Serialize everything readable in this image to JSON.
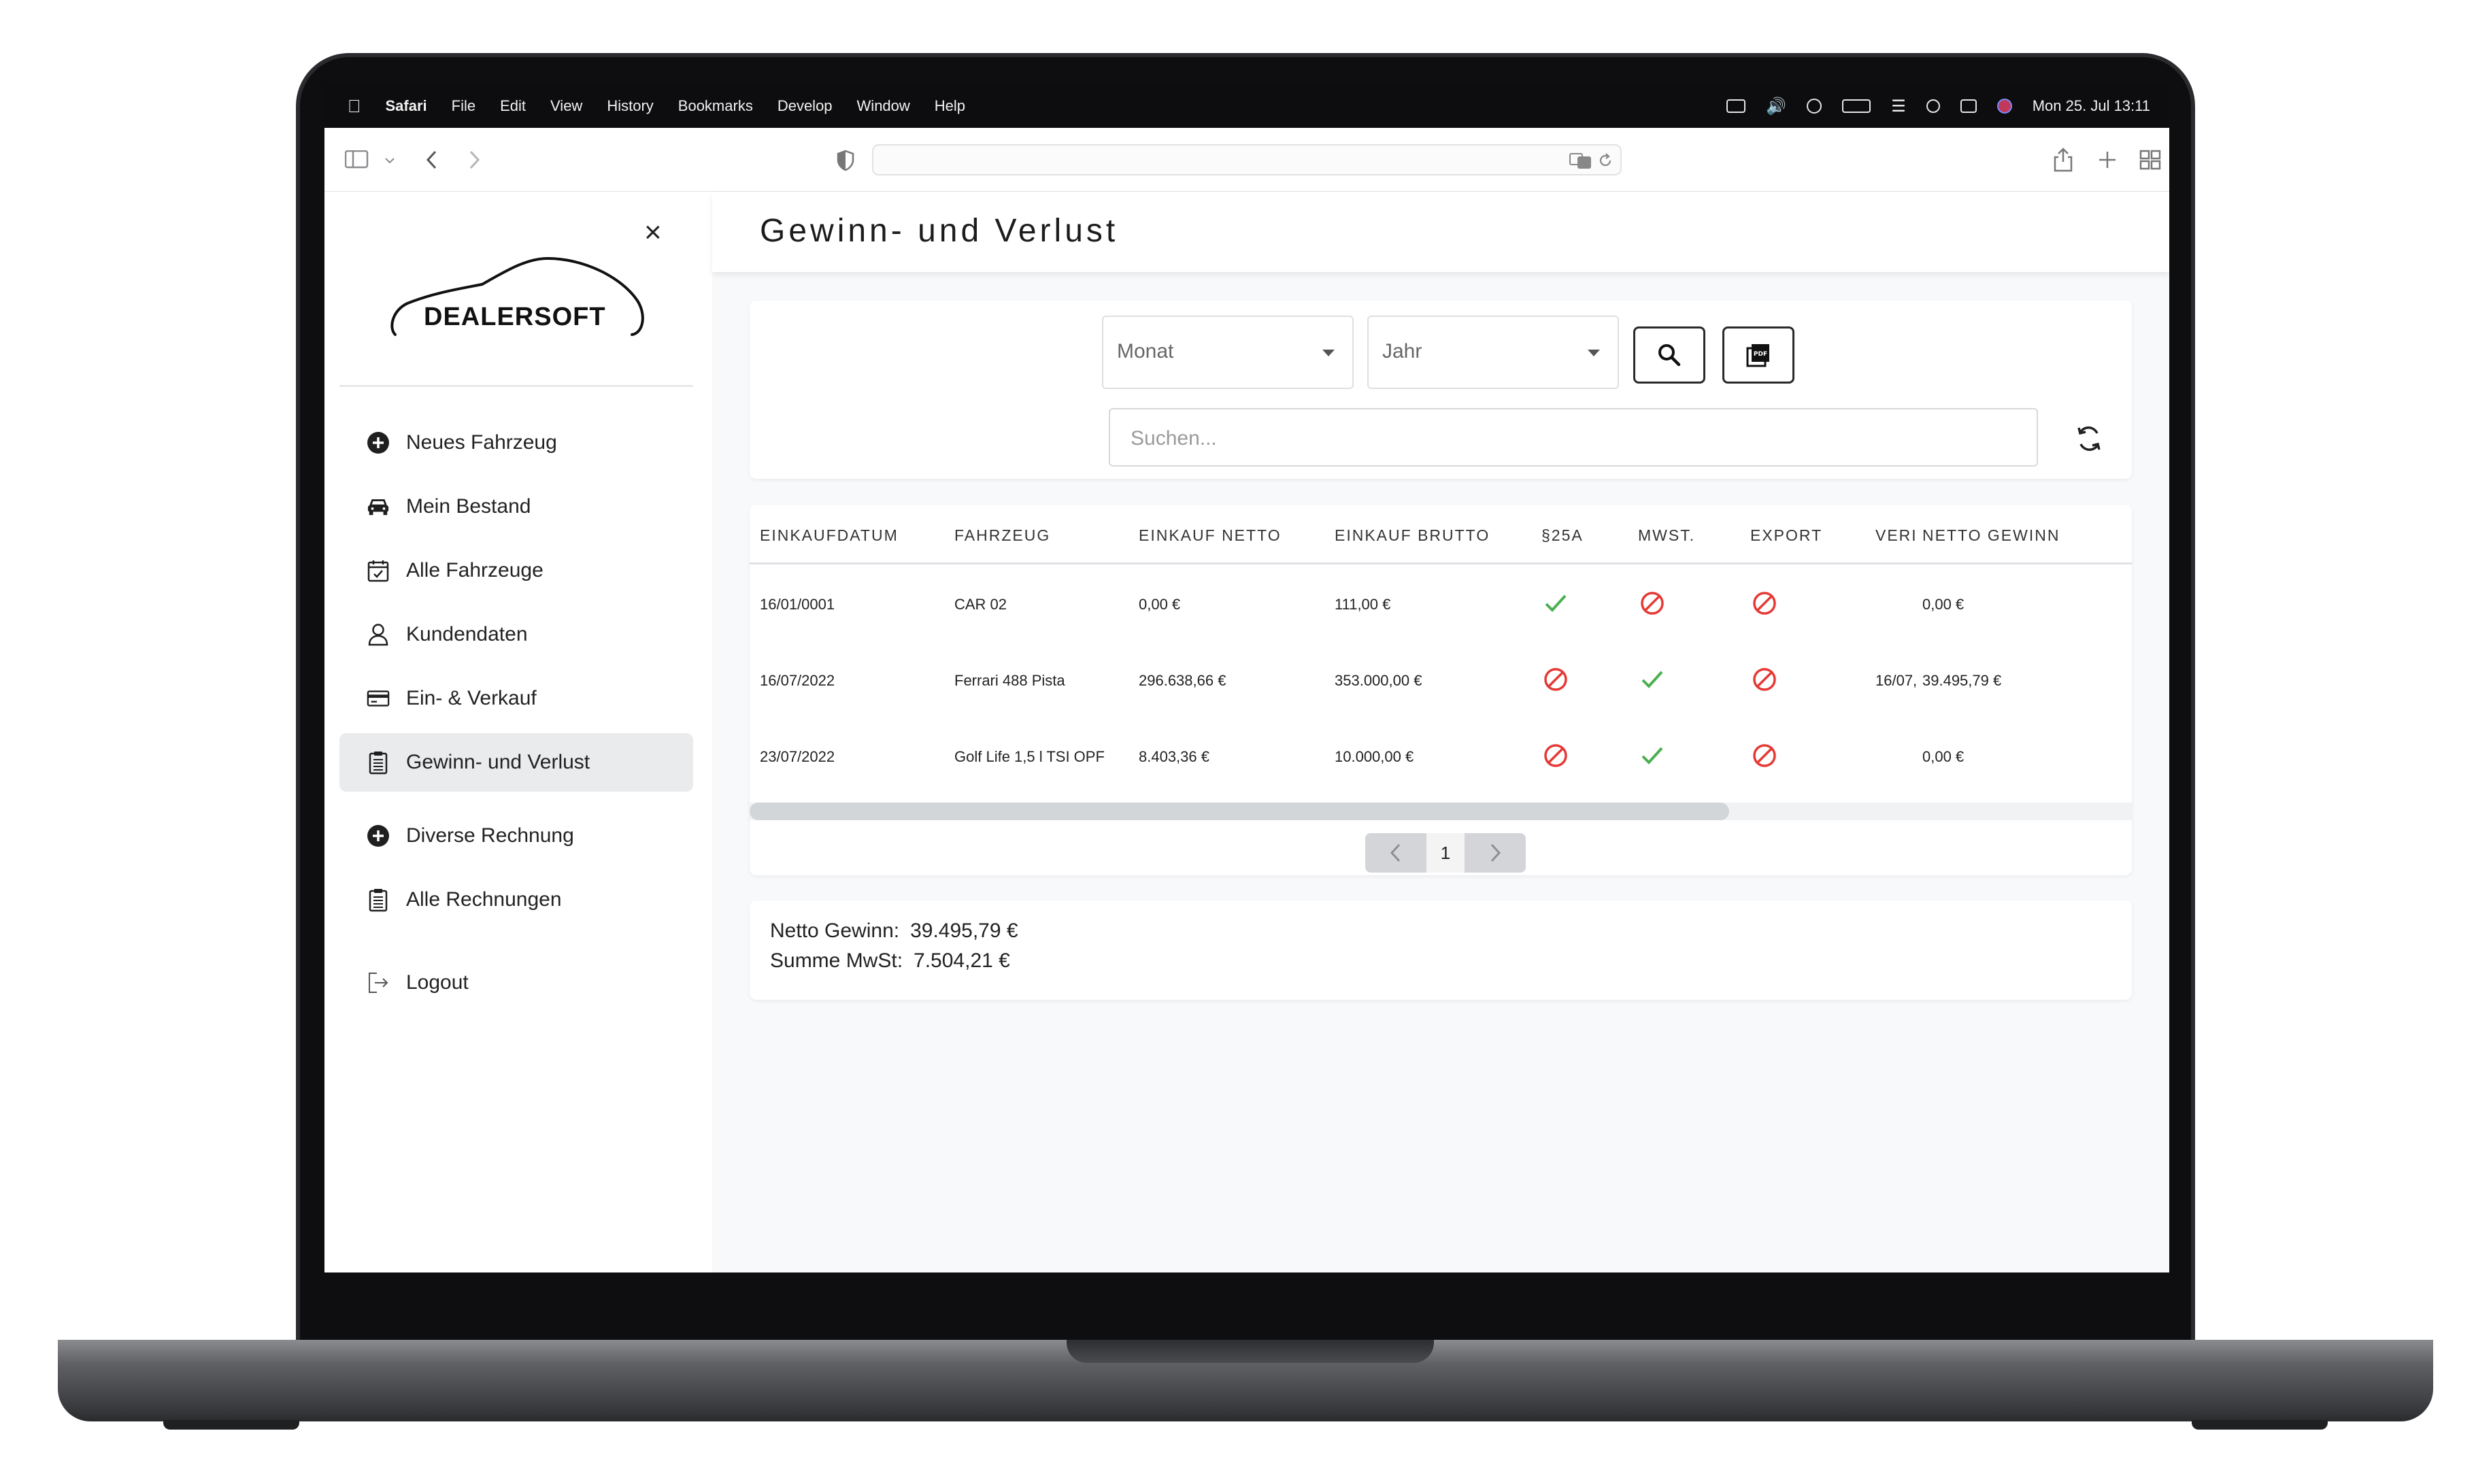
{
  "menubar": {
    "app": "Safari",
    "items": [
      "File",
      "Edit",
      "View",
      "History",
      "Bookmarks",
      "Develop",
      "Window",
      "Help"
    ],
    "clock": "Mon 25. Jul  13:11"
  },
  "sidebar": {
    "logo_text": "DEALERSOFT",
    "close_label": "×",
    "items": [
      {
        "label": "Neues Fahrzeug",
        "icon": "plus-circle-icon"
      },
      {
        "label": "Mein Bestand",
        "icon": "car-icon"
      },
      {
        "label": "Alle Fahrzeuge",
        "icon": "calendar-check-icon"
      },
      {
        "label": "Kundendaten",
        "icon": "user-icon"
      },
      {
        "label": "Ein- & Verkauf",
        "icon": "card-icon"
      },
      {
        "label": "Gewinn- und Verlust",
        "icon": "clipboard-icon",
        "active": true
      },
      {
        "label": "Diverse Rechnung",
        "icon": "plus-circle-icon"
      },
      {
        "label": "Alle Rechnungen",
        "icon": "clipboard-icon"
      },
      {
        "label": "Logout",
        "icon": "logout-icon"
      }
    ]
  },
  "page": {
    "title": "Gewinn- und Verlust"
  },
  "filters": {
    "month_placeholder": "Monat",
    "year_placeholder": "Jahr",
    "search_placeholder": "Suchen..."
  },
  "table": {
    "columns": [
      "EINKAUFDATUM",
      "FAHRZEUG",
      "EINKAUF NETTO",
      "EINKAUF BRUTTO",
      "§25A",
      "MWST.",
      "EXPORT",
      "VERI",
      "NETTO GEWINN"
    ],
    "rows": [
      {
        "date": "16/01/0001",
        "vehicle": "CAR 02",
        "net": "0,00 €",
        "gross": "111,00 €",
        "p25a": "check",
        "mwst": "cross",
        "export": "cross",
        "veri": "",
        "profit": "0,00 €"
      },
      {
        "date": "16/07/2022",
        "vehicle": "Ferrari 488 Pista",
        "net": "296.638,66 €",
        "gross": "353.000,00 €",
        "p25a": "cross",
        "mwst": "check",
        "export": "cross",
        "veri": "16/07,",
        "profit": "39.495,79 €"
      },
      {
        "date": "23/07/2022",
        "vehicle": "Golf Life 1,5 l TSI OPF",
        "net": "8.403,36 €",
        "gross": "10.000,00 €",
        "p25a": "cross",
        "mwst": "check",
        "export": "cross",
        "veri": "",
        "profit": "0,00 €"
      }
    ],
    "page": "1"
  },
  "summary": {
    "net_label": "Netto Gewinn:",
    "net_value": "39.495,79 €",
    "vat_label": "Summe MwSt:",
    "vat_value": "7.504,21 €"
  },
  "colors": {
    "check": "#4caf50",
    "cross": "#e53935",
    "active_nav": "#eaebed"
  }
}
